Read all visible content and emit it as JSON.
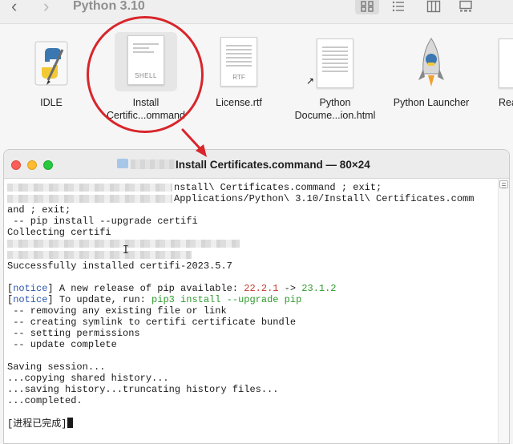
{
  "finder": {
    "title": "Python 3.10",
    "items": [
      {
        "label": "IDLE",
        "icon": "idle-app-icon"
      },
      {
        "label_line1": "Install",
        "label_line2": "Certific...ommand",
        "icon": "shell-script-icon",
        "icon_text": "SHELL"
      },
      {
        "label": "License.rtf",
        "icon": "rtf-document-icon",
        "icon_text": "RTF"
      },
      {
        "label_line1": "Python",
        "label_line2": "Docume...ion.html",
        "icon": "html-document-icon"
      },
      {
        "label": "Python Launcher",
        "icon": "python-launcher-icon"
      },
      {
        "label": "Rea",
        "icon": "readme-icon"
      }
    ]
  },
  "terminal": {
    "title": "Install Certificates.command — 80×24",
    "lines": {
      "l1": "nstall\\ Certificates.command ; exit;",
      "l2": "Applications/Python\\ 3.10/Install\\ Certificates.comm",
      "l3": "and ; exit;",
      "l4": " -- pip install --upgrade certifi",
      "l5": "Collecting certifi",
      "l6": "Successfully installed certifi-2023.5.7",
      "n1_tag": "notice",
      "n1_text": " A new release of pip available: ",
      "n1_old": "22.2.1",
      "n1_arrow": " -> ",
      "n1_new": "23.1.2",
      "n2_tag": "notice",
      "n2_text": " To update, run: ",
      "n2_cmd": "pip3 install --upgrade pip",
      "l7": " -- removing any existing file or link",
      "l8": " -- creating symlink to certifi certificate bundle",
      "l9": " -- setting permissions",
      "l10": " -- update complete",
      "l11": "Saving session...",
      "l12": "...copying shared history...",
      "l13": "...saving history...truncating history files...",
      "l14": "...completed.",
      "l15": "[进程已完成]"
    }
  },
  "colors": {
    "annotation": "#d8262b",
    "notice": "#2b57a8",
    "version_old": "#c23a2e",
    "version_new": "#2f9a2f"
  }
}
